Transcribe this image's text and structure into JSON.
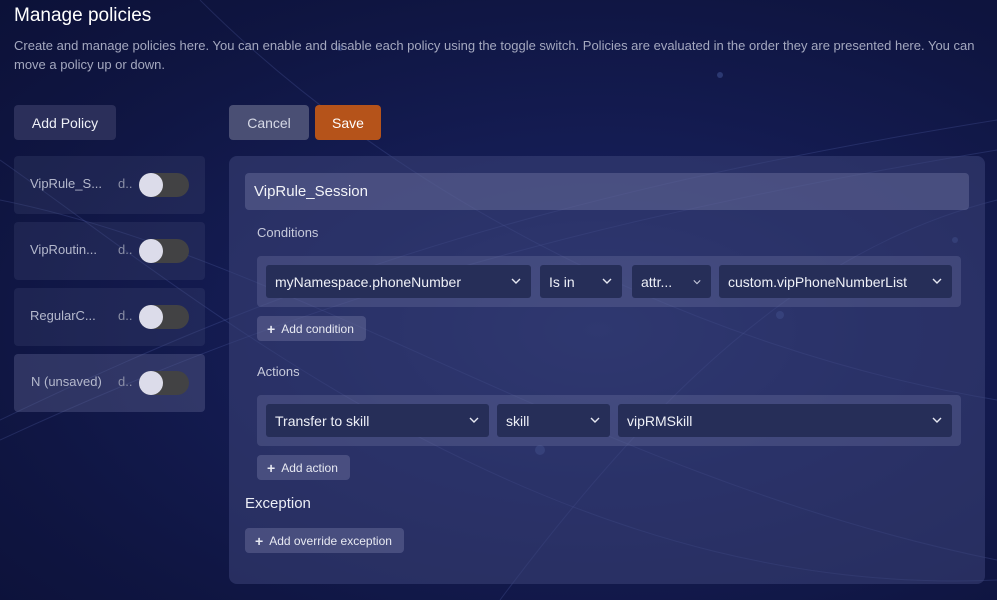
{
  "header": {
    "title": "Manage policies",
    "description": "Create and manage policies here. You can enable and disable each policy using the toggle switch. Policies are evaluated in the order they are presented here. You can move a policy up or down."
  },
  "toolbar": {
    "add_policy_label": "Add Policy",
    "cancel_label": "Cancel",
    "save_label": "Save"
  },
  "policies": [
    {
      "name": "VipRule_S...",
      "sub": "d..",
      "enabled": false
    },
    {
      "name": "VipRoutin...",
      "sub": "d..",
      "enabled": false
    },
    {
      "name": "RegularC...",
      "sub": "d..",
      "enabled": false
    },
    {
      "name": "N (unsaved)",
      "sub": "d..",
      "enabled": false
    }
  ],
  "editor": {
    "policy_name": "VipRule_Session",
    "conditions_label": "Conditions",
    "condition": {
      "field": "myNamespace.phoneNumber",
      "operator": "Is in",
      "type": "attr...",
      "value": "custom.vipPhoneNumberList"
    },
    "add_condition_label": "Add condition",
    "actions_label": "Actions",
    "action": {
      "type": "Transfer to skill",
      "target": "skill",
      "value": "vipRMSkill"
    },
    "add_action_label": "Add action",
    "exception_label": "Exception",
    "add_exception_label": "Add override exception"
  },
  "colors": {
    "save_accent": "#b5531a",
    "background": "#131a4d"
  }
}
